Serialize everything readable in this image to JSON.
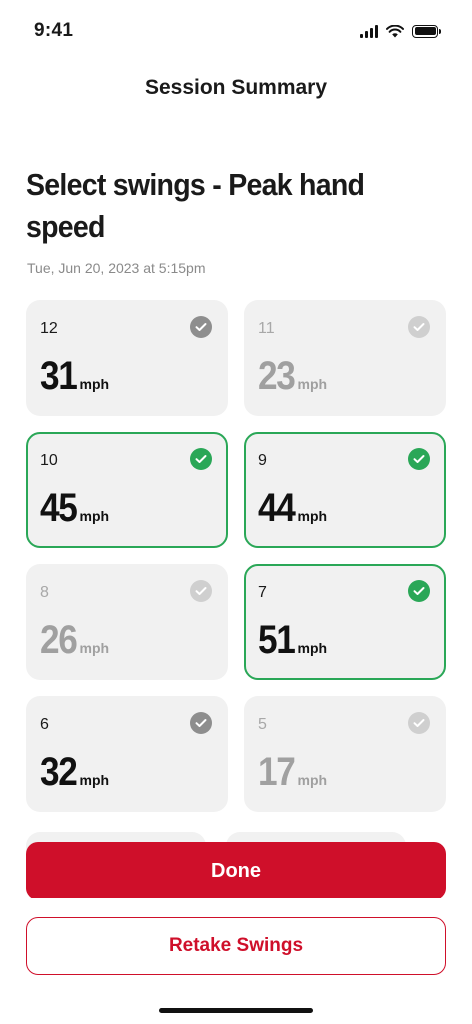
{
  "status_bar": {
    "time": "9:41"
  },
  "nav": {
    "title": "Session Summary"
  },
  "page": {
    "heading": "Select swings - Peak hand speed",
    "date": "Tue, Jun 20, 2023 at 5:15pm"
  },
  "swings": [
    {
      "number": "12",
      "speed": "31",
      "unit": "mph",
      "state": "unselected"
    },
    {
      "number": "11",
      "speed": "23",
      "unit": "mph",
      "state": "dim"
    },
    {
      "number": "10",
      "speed": "45",
      "unit": "mph",
      "state": "selected"
    },
    {
      "number": "9",
      "speed": "44",
      "unit": "mph",
      "state": "selected"
    },
    {
      "number": "8",
      "speed": "26",
      "unit": "mph",
      "state": "dim"
    },
    {
      "number": "7",
      "speed": "51",
      "unit": "mph",
      "state": "selected"
    },
    {
      "number": "6",
      "speed": "32",
      "unit": "mph",
      "state": "unselected"
    },
    {
      "number": "5",
      "speed": "17",
      "unit": "mph",
      "state": "dim"
    }
  ],
  "actions": {
    "done_label": "Done",
    "retake_label": "Retake Swings"
  },
  "colors": {
    "accent_red": "#cf0f2a",
    "selected_green": "#2aa757",
    "card_bg": "#f1f1f1"
  },
  "icons": {
    "check": "check-circle-icon",
    "signal": "cellular-signal-icon",
    "wifi": "wifi-icon",
    "battery": "battery-icon"
  }
}
